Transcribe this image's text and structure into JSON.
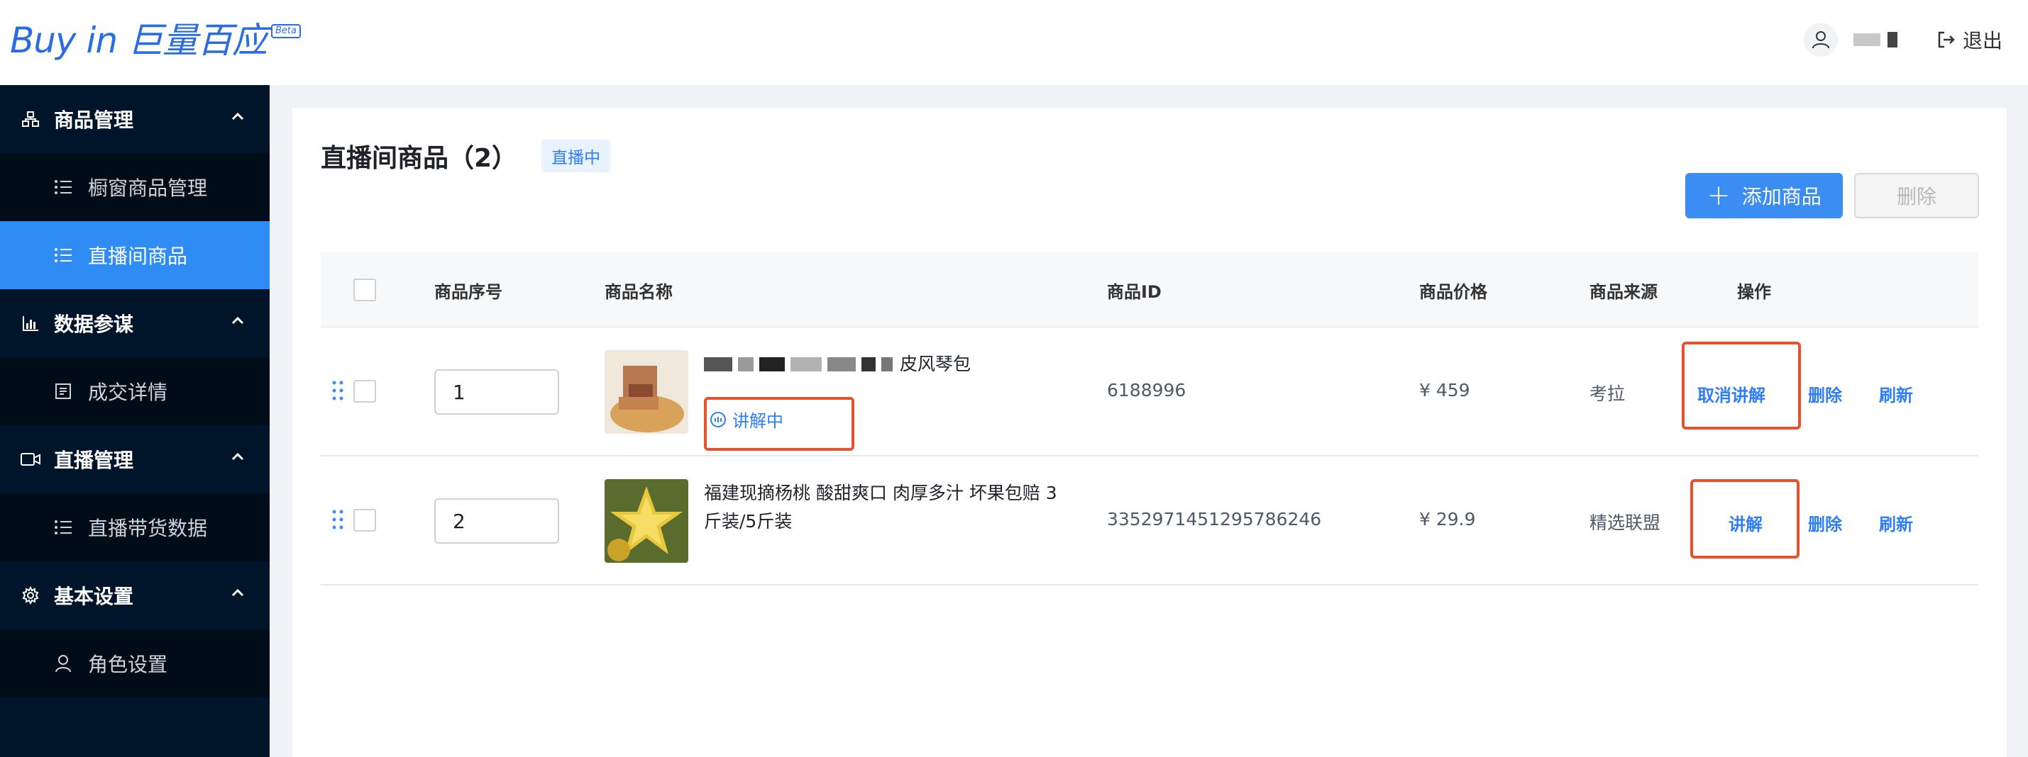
{
  "header": {
    "logo_text": "Buy in 巨量百应",
    "logo_badge": "Beta",
    "logout_label": "退出"
  },
  "sidebar": {
    "groups": [
      {
        "label": "商品管理",
        "icon": "org-chart-icon",
        "items": [
          {
            "label": "橱窗商品管理",
            "icon": "list-icon",
            "active": false
          },
          {
            "label": "直播间商品",
            "icon": "list-icon",
            "active": true
          }
        ]
      },
      {
        "label": "数据参谋",
        "icon": "bar-chart-icon",
        "items": [
          {
            "label": "成交详情",
            "icon": "document-icon",
            "active": false
          }
        ]
      },
      {
        "label": "直播管理",
        "icon": "video-camera-icon",
        "items": [
          {
            "label": "直播带货数据",
            "icon": "list-icon",
            "active": false
          }
        ]
      },
      {
        "label": "基本设置",
        "icon": "gear-icon",
        "items": [
          {
            "label": "角色设置",
            "icon": "user-icon",
            "active": false
          }
        ]
      }
    ]
  },
  "main": {
    "title": "直播间商品（2）",
    "status_tag": "直播中",
    "add_button": "添加商品",
    "delete_button": "删除"
  },
  "table": {
    "columns": [
      "商品序号",
      "商品名称",
      "商品ID",
      "商品价格",
      "商品来源",
      "操作"
    ],
    "rows": [
      {
        "seq": "1",
        "name": "皮风琴包",
        "explaining_badge": "讲解中",
        "id": "6188996",
        "price": "¥ 459",
        "source": "考拉",
        "actions": [
          "取消讲解",
          "删除",
          "刷新"
        ]
      },
      {
        "seq": "2",
        "name": "福建现摘杨桃 酸甜爽口 肉厚多汁 坏果包赔 3斤装/5斤装",
        "id": "3352971451295786246",
        "price": "¥ 29.9",
        "source": "精选联盟",
        "actions": [
          "讲解",
          "删除",
          "刷新"
        ]
      }
    ]
  }
}
